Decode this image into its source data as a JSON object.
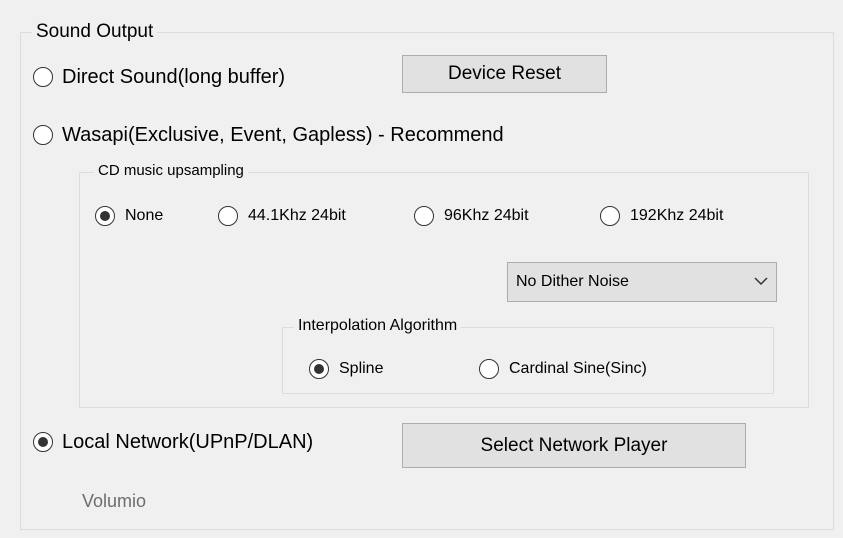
{
  "sound_output": {
    "legend": "Sound Output",
    "direct_sound": {
      "label": "Direct Sound(long buffer)",
      "selected": false
    },
    "device_reset": "Device Reset",
    "wasapi": {
      "label": "Wasapi(Exclusive, Event, Gapless) - Recommend",
      "selected": false
    },
    "cd_upsampling": {
      "legend": "CD music upsampling",
      "options": [
        {
          "label": "None",
          "selected": true
        },
        {
          "label": "44.1Khz 24bit",
          "selected": false
        },
        {
          "label": "96Khz 24bit",
          "selected": false
        },
        {
          "label": "192Khz 24bit",
          "selected": false
        }
      ],
      "dither_select": {
        "value": "No Dither Noise",
        "icon": "chevron-down-icon"
      },
      "interpolation": {
        "legend": "Interpolation Algorithm",
        "options": [
          {
            "label": "Spline",
            "selected": true
          },
          {
            "label": "Cardinal Sine(Sinc)",
            "selected": false
          }
        ]
      }
    },
    "local_network": {
      "label": "Local Network(UPnP/DLAN)",
      "selected": true
    },
    "select_network_player": "Select Network Player",
    "network_player_name": "Volumio"
  }
}
